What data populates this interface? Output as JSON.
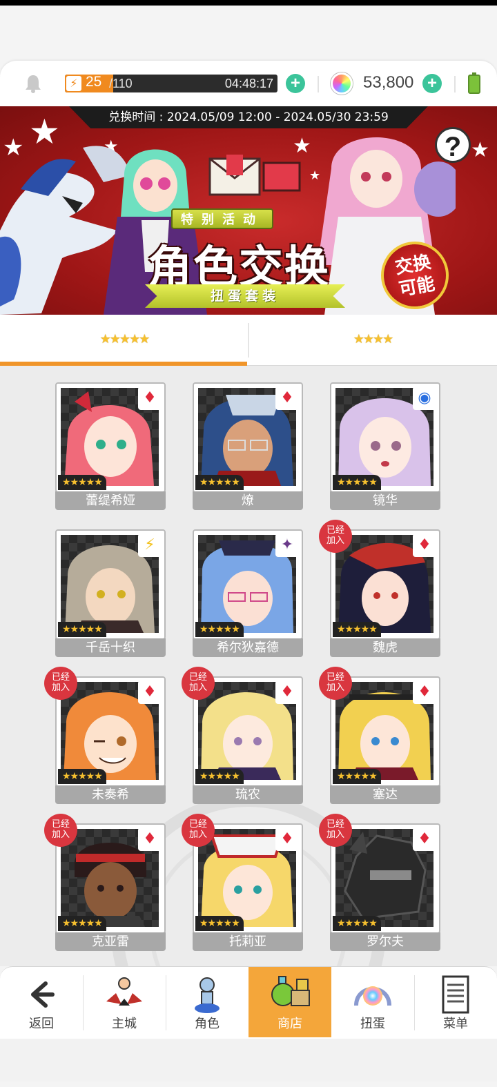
{
  "status": {
    "stamina_current": "25",
    "stamina_max": "/110",
    "stamina_fraction": 0.227,
    "stamina_timer": "04:48:17",
    "gem_amount": "53,800",
    "icons": [
      "bell-icon",
      "lightning-icon",
      "plus-icon",
      "gem-icon",
      "battery-icon"
    ]
  },
  "banner": {
    "period": "兑换时间 : 2024.05/09 12:00 - 2024.05/30 23:59",
    "tag": "特别活动",
    "title": "角色交换",
    "subtitle": "扭蛋套装",
    "badge": "交换可能",
    "help": "?"
  },
  "tabs": [
    {
      "label": "★★★★★",
      "active": true
    },
    {
      "label": "★★★★",
      "active": false
    }
  ],
  "characters": [
    {
      "name": "蕾缇希娅",
      "stars": "★★★★★",
      "element": "fire-element-icon",
      "added": false
    },
    {
      "name": "燎",
      "stars": "★★★★★",
      "element": "fire-element-icon",
      "added": false
    },
    {
      "name": "镜华",
      "stars": "★★★★★",
      "element": "water-element-icon",
      "added": false
    },
    {
      "name": "千岳十织",
      "stars": "★★★★★",
      "element": "wind-element-icon",
      "added": false
    },
    {
      "name": "希尔狄嘉德",
      "stars": "★★★★★",
      "element": "shadow-element-icon",
      "added": false
    },
    {
      "name": "魏虎",
      "stars": "★★★★★",
      "element": "fire-element-icon",
      "added": true
    },
    {
      "name": "未奏希",
      "stars": "★★★★★",
      "element": "fire-element-icon",
      "added": true
    },
    {
      "name": "琉农",
      "stars": "★★★★★",
      "element": "fire-element-icon",
      "added": true
    },
    {
      "name": "塞达",
      "stars": "★★★★★",
      "element": "fire-element-icon",
      "added": true
    },
    {
      "name": "克亚雷",
      "stars": "★★★★★",
      "element": "fire-element-icon",
      "added": true
    },
    {
      "name": "托莉亚",
      "stars": "★★★★★",
      "element": "fire-element-icon",
      "added": true
    },
    {
      "name": "罗尔夫",
      "stars": "★★★★★",
      "element": "fire-element-icon",
      "added": true
    }
  ],
  "added_badge": "已经\n加入",
  "nav": [
    {
      "label": "返回",
      "icon": "back-arrow-icon"
    },
    {
      "label": "主城",
      "icon": "home-castle-icon"
    },
    {
      "label": "角色",
      "icon": "character-icon"
    },
    {
      "label": "商店",
      "icon": "shop-icon",
      "active": true
    },
    {
      "label": "扭蛋",
      "icon": "gacha-icon"
    },
    {
      "label": "菜单",
      "icon": "menu-list-icon"
    }
  ],
  "colors": {
    "accent": "#f0952a",
    "stamina": "#f08a1f",
    "plus": "#3bc49a",
    "banner_red": "#b21e1e",
    "added_badge": "#d9363f",
    "fire": "#e0283a",
    "water": "#2a6fe0",
    "wind": "#f3c220",
    "shadow": "#6a3a8a"
  }
}
